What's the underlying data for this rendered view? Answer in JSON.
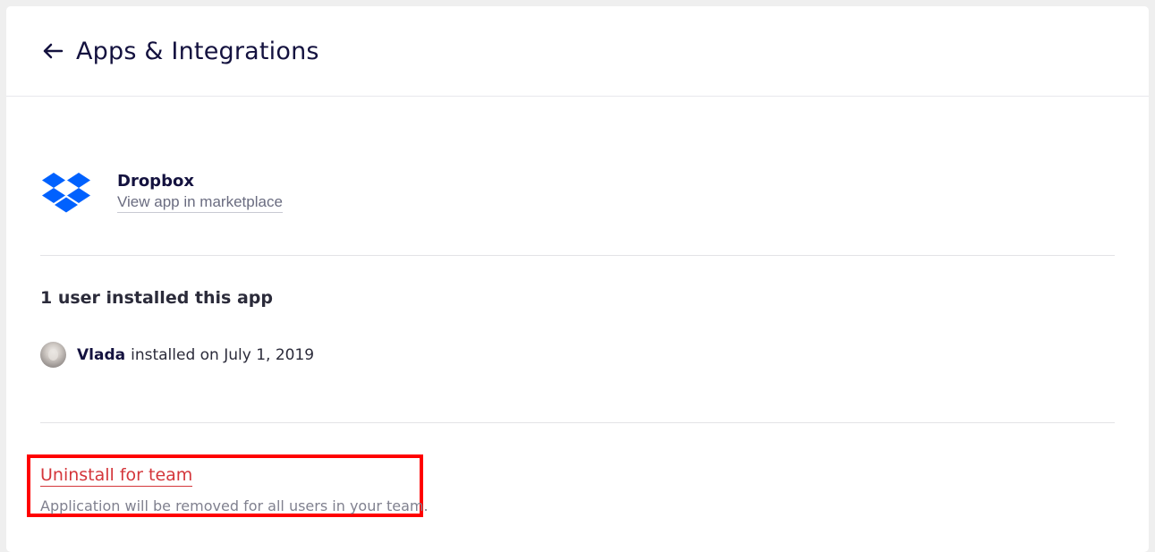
{
  "header": {
    "title": "Apps & Integrations",
    "back_icon": "arrow-left-icon"
  },
  "app": {
    "name": "Dropbox",
    "marketplace_link": "View app in marketplace",
    "logo_icon": "dropbox-logo-icon",
    "logo_color": "#0061fe"
  },
  "installs": {
    "heading": "1 user installed this app",
    "items": [
      {
        "user": "Vlada",
        "text": "installed on July 1, 2019"
      }
    ]
  },
  "danger": {
    "uninstall_label": "Uninstall for team",
    "description": "Application will be removed for all users in your team.",
    "accent_color": "#d4363b",
    "highlight_color": "#ff0000"
  }
}
